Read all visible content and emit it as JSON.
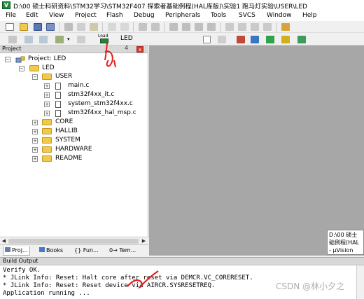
{
  "window": {
    "title": "D:\\00 硕士科研资料\\STM32学习\\STM32F407 探索者基础例程(HAL库版)\\实验1 跑马灯实验\\USER\\LED",
    "app_icon": "uvision-icon"
  },
  "menu": [
    "File",
    "Edit",
    "View",
    "Project",
    "Flash",
    "Debug",
    "Peripherals",
    "Tools",
    "SVCS",
    "Window",
    "Help"
  ],
  "toolbar2": {
    "load_label": "Load",
    "target_label": "LED"
  },
  "project_panel": {
    "title": "Project",
    "pin_symbol": "4",
    "close_symbol": "x",
    "tree": {
      "project": "Project: LED",
      "target": "LED",
      "groups": [
        {
          "name": "USER",
          "expanded": true,
          "files": [
            "main.c",
            "stm32f4xx_it.c",
            "system_stm32f4xx.c",
            "stm32f4xx_hal_msp.c"
          ]
        },
        {
          "name": "CORE",
          "expanded": false,
          "files": []
        },
        {
          "name": "HALLIB",
          "expanded": false,
          "files": []
        },
        {
          "name": "SYSTEM",
          "expanded": false,
          "files": []
        },
        {
          "name": "HARDWARE",
          "expanded": false,
          "files": []
        },
        {
          "name": "README",
          "expanded": false,
          "files": []
        }
      ]
    },
    "tabs": [
      "Proj...",
      "Books",
      "{} Fun...",
      "0→ Tem..."
    ]
  },
  "tooltip": {
    "lines": [
      "D:\\00 硕士",
      "础例程(HAL",
      "- µVision"
    ]
  },
  "build_output": {
    "title": "Build Output",
    "lines": [
      "Verify OK.",
      "* JLink Info: Reset: Halt core after reset via DEMCR.VC_CORERESET.",
      "* JLink Info: Reset: Reset device via AIRCR.SYSRESETREQ.",
      "Application running ..."
    ]
  },
  "watermark": "CSDN @林小夕之",
  "colors": {
    "annotation": "#e41e1e",
    "editor_bg": "#a7a7a7"
  }
}
